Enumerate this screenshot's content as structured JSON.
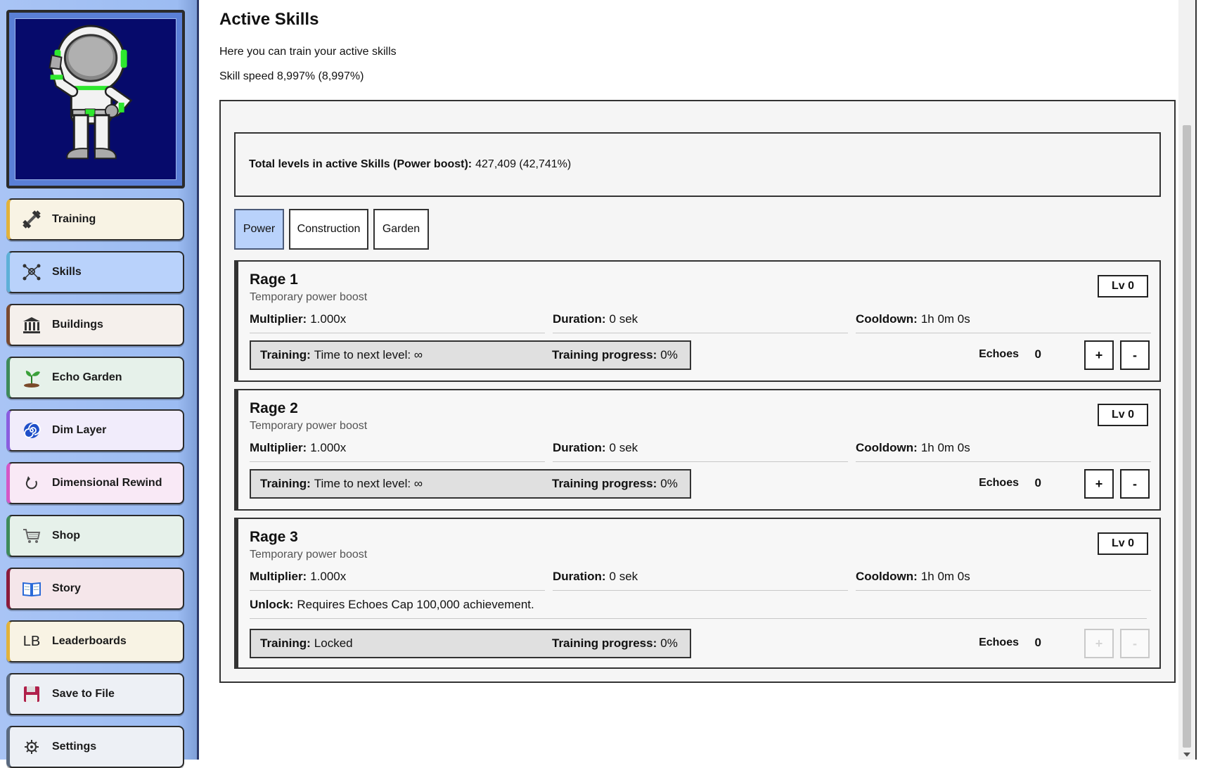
{
  "sidebar": {
    "items": [
      {
        "label": "Training",
        "icon": "dumbbell-icon",
        "bg": "#f8f3e4",
        "accent": "#e2b23c"
      },
      {
        "label": "Skills",
        "icon": "skills-network-icon",
        "bg": "#b9d2fb",
        "accent": "#5db0d8"
      },
      {
        "label": "Buildings",
        "icon": "building-icon",
        "bg": "#f5f0ec",
        "accent": "#7a4a30"
      },
      {
        "label": "Echo Garden",
        "icon": "sprout-icon",
        "bg": "#e6f1ea",
        "accent": "#3e8a5a"
      },
      {
        "label": "Dim Layer",
        "icon": "spiral-icon",
        "bg": "#f1ecfb",
        "accent": "#8a5de0"
      },
      {
        "label": "Dimensional Rewind",
        "icon": "rewind-icon",
        "bg": "#f9e9f6",
        "accent": "#d557c6"
      },
      {
        "label": "Shop",
        "icon": "cart-icon",
        "bg": "#e6f1ea",
        "accent": "#3e8a5a"
      },
      {
        "label": "Story",
        "icon": "book-icon",
        "bg": "#f5e6ea",
        "accent": "#8a1b3c"
      },
      {
        "label": "Leaderboards",
        "icon": "leaderboard-icon",
        "icon_text": "LB",
        "bg": "#f8f3e4",
        "accent": "#e2b23c"
      },
      {
        "label": "Save to File",
        "icon": "floppy-icon",
        "bg": "#edf0f5",
        "accent": "#5a6a80"
      },
      {
        "label": "Settings",
        "icon": "gear-icon",
        "bg": "#edf0f5",
        "accent": "#5a6a80"
      }
    ]
  },
  "page": {
    "title": "Active Skills",
    "description": "Here you can train your active skills",
    "speed": "Skill speed 8,997% (8,997%)"
  },
  "total": {
    "label": "Total levels in active Skills (Power boost):",
    "value": "427,409 (42,741%)"
  },
  "tabs": [
    {
      "label": "Power",
      "active": true
    },
    {
      "label": "Construction",
      "active": false
    },
    {
      "label": "Garden",
      "active": false
    }
  ],
  "skills": [
    {
      "name": "Rage 1",
      "desc": "Temporary power boost",
      "level": "Lv 0",
      "multiplier_label": "Multiplier:",
      "multiplier": "1.000x",
      "duration_label": "Duration:",
      "duration": "0 sek",
      "cooldown_label": "Cooldown:",
      "cooldown": "1h 0m 0s",
      "training_label": "Training:",
      "training": "Time to next level: ∞",
      "progress_label": "Training progress:",
      "progress": "0%",
      "echoes_label": "Echoes",
      "echoes": "0",
      "plus": "+",
      "minus": "-",
      "locked": false
    },
    {
      "name": "Rage 2",
      "desc": "Temporary power boost",
      "level": "Lv 0",
      "multiplier_label": "Multiplier:",
      "multiplier": "1.000x",
      "duration_label": "Duration:",
      "duration": "0 sek",
      "cooldown_label": "Cooldown:",
      "cooldown": "1h 0m 0s",
      "training_label": "Training:",
      "training": "Time to next level: ∞",
      "progress_label": "Training progress:",
      "progress": "0%",
      "echoes_label": "Echoes",
      "echoes": "0",
      "plus": "+",
      "minus": "-",
      "locked": false
    },
    {
      "name": "Rage 3",
      "desc": "Temporary power boost",
      "level": "Lv 0",
      "multiplier_label": "Multiplier:",
      "multiplier": "1.000x",
      "duration_label": "Duration:",
      "duration": "0 sek",
      "cooldown_label": "Cooldown:",
      "cooldown": "1h 0m 0s",
      "unlock_label": "Unlock:",
      "unlock": "Requires Echoes Cap 100,000 achievement.",
      "training_label": "Training:",
      "training": "Locked",
      "progress_label": "Training progress:",
      "progress": "0%",
      "echoes_label": "Echoes",
      "echoes": "0",
      "plus": "+",
      "minus": "-",
      "locked": true
    }
  ]
}
